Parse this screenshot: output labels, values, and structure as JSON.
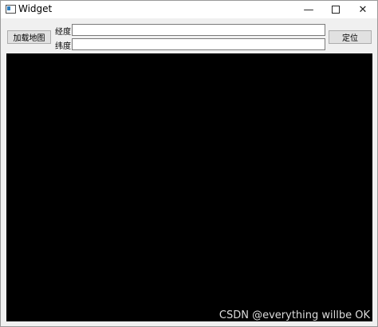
{
  "window": {
    "title": "Widget",
    "minimize_glyph": "—",
    "close_glyph": "✕"
  },
  "toolbar": {
    "load_map_label": "加载地图",
    "longitude_label": "经度",
    "latitude_label": "纬度",
    "longitude_value": "",
    "latitude_value": "",
    "locate_label": "定位"
  },
  "map": {
    "background": "#000000"
  },
  "watermark": {
    "text": "CSDN @everything willbe OK"
  }
}
